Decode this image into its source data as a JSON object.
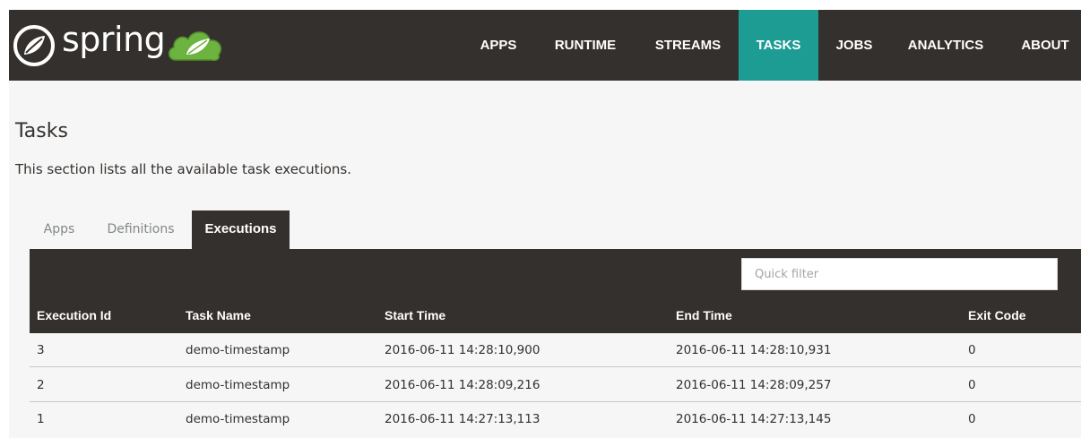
{
  "header": {
    "logo_text": "spring",
    "nav": [
      {
        "label": "APPS"
      },
      {
        "label": "RUNTIME"
      },
      {
        "label": "STREAMS"
      },
      {
        "label": "TASKS",
        "active": true
      },
      {
        "label": "JOBS"
      },
      {
        "label": "ANALYTICS"
      },
      {
        "label": "ABOUT"
      }
    ]
  },
  "page": {
    "title": "Tasks",
    "description": "This section lists all the available task executions."
  },
  "tabs": [
    {
      "label": "Apps"
    },
    {
      "label": "Definitions"
    },
    {
      "label": "Executions",
      "active": true
    }
  ],
  "filter": {
    "placeholder": "Quick filter",
    "value": ""
  },
  "table": {
    "columns": [
      "Execution Id",
      "Task Name",
      "Start Time",
      "End Time",
      "Exit Code"
    ],
    "rows": [
      [
        "3",
        "demo-timestamp",
        "2016-06-11 14:28:10,900",
        "2016-06-11 14:28:10,931",
        "0"
      ],
      [
        "2",
        "demo-timestamp",
        "2016-06-11 14:28:09,216",
        "2016-06-11 14:28:09,257",
        "0"
      ],
      [
        "1",
        "demo-timestamp",
        "2016-06-11 14:27:13,113",
        "2016-06-11 14:27:13,145",
        "0"
      ]
    ]
  },
  "colors": {
    "header_bg": "#34302d",
    "accent": "#1c9c93",
    "logo_green": "#6db33f"
  }
}
